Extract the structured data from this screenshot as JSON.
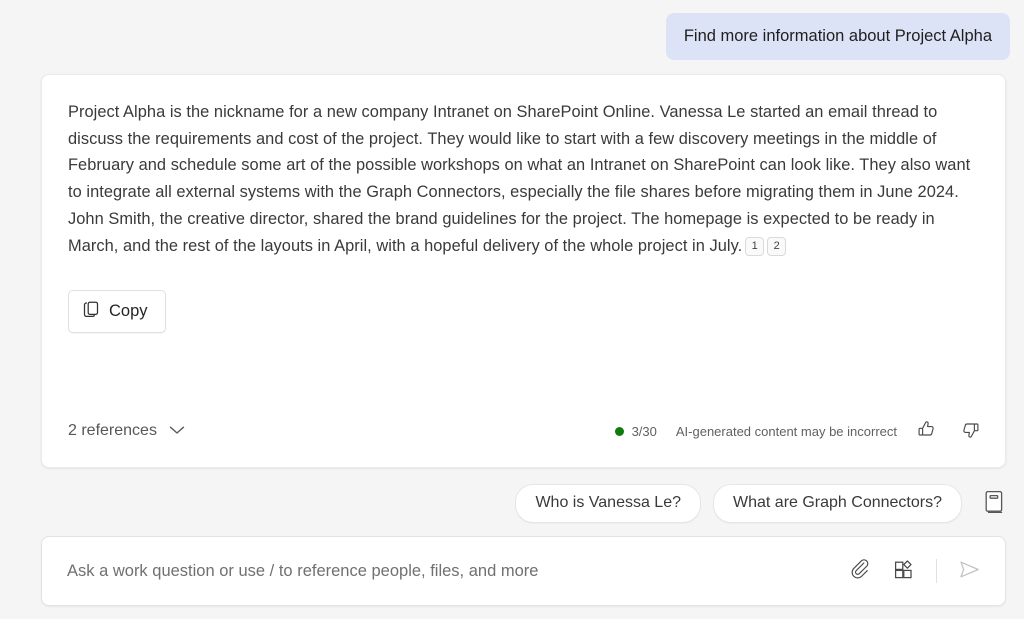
{
  "conversation": {
    "user_message": "Find more information about Project Alpha",
    "answer": {
      "body": "Project Alpha is the nickname for a new company Intranet on SharePoint Online. Vanessa Le started an email thread to discuss the requirements and cost of the project. They would like to start with a few discovery meetings in the middle of February and schedule some art of the possible workshops on what an Intranet on SharePoint can look like. They also want to integrate all external systems with the Graph Connectors, especially the file shares before migrating them in June 2024. John Smith, the creative director, shared the brand guidelines for the project. The homepage is expected to be ready in March, and the rest of the layouts in April, with a hopeful delivery of the whole project in July.",
      "citations": [
        "1",
        "2"
      ],
      "copy_label": "Copy",
      "copy_icon": "copy-icon",
      "references_label": "2 references",
      "references_chevron_icon": "chevron-down-icon",
      "usage_count": "3/30",
      "usage_status_color": "#107c10",
      "disclaimer": "AI-generated content may be incorrect",
      "thumbs_up_icon": "thumbs-up-icon",
      "thumbs_down_icon": "thumbs-down-icon"
    }
  },
  "suggestions": {
    "chips": [
      {
        "label": "Who is Vanessa Le?"
      },
      {
        "label": "What are Graph Connectors?"
      }
    ],
    "guide_icon": "prompt-guide-book-icon"
  },
  "composer": {
    "placeholder": "Ask a work question or use / to reference people, files, and more",
    "value": "",
    "attach_icon": "paperclip-icon",
    "plugins_icon": "apps-grid-icon",
    "send_icon": "send-plane-icon"
  },
  "theme": {
    "page_background": "#f5f5f5",
    "user_bubble": "#dde3f7",
    "card_background": "#ffffff",
    "accent_green": "#107c10"
  }
}
